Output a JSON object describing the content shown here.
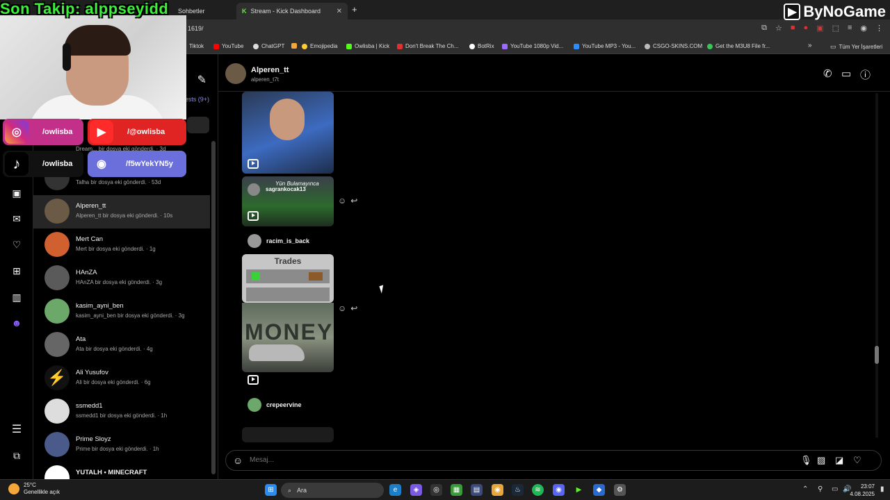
{
  "overlay": {
    "stream_text": "Son Takip: alppseyidd"
  },
  "brand": {
    "name": "ByNoGame"
  },
  "browser": {
    "tabs": [
      {
        "label": "Sohbetler",
        "active": false
      },
      {
        "label": "Stream - Kick Dashboard",
        "active": false
      }
    ],
    "new_tab": "+",
    "url": "1619/",
    "bookmarks": [
      {
        "label": "Tiktok",
        "color": "#ffffff"
      },
      {
        "label": "YouTube",
        "color": "#ff0000"
      },
      {
        "label": "ChatGPT",
        "color": "#dddddd"
      },
      {
        "label": "",
        "color": "#f4a83a"
      },
      {
        "label": "Emojipedia",
        "color": "#ffcc33"
      },
      {
        "label": "Owlisba | Kick",
        "color": "#53fc18"
      },
      {
        "label": "Don't Break The Ch...",
        "color": "#e03030"
      },
      {
        "label": "BotRix",
        "color": "#ffffff"
      },
      {
        "label": "YouTube 1080p Vid...",
        "color": "#9b6bff"
      },
      {
        "label": "YouTube MP3 - You...",
        "color": "#2a8cff"
      },
      {
        "label": "CSGO-SKINS.COM",
        "color": "#bbbbbb"
      },
      {
        "label": "Get the M3U8 File fr...",
        "color": "#38c55a"
      },
      {
        "label": "»",
        "color": ""
      },
      {
        "label": "Tüm Yer İşaretleri",
        "color": ""
      }
    ]
  },
  "socials": [
    {
      "label": "/owlisba",
      "icon": "instagram-icon",
      "color": "#c3308a"
    },
    {
      "label": "/@owlisba",
      "icon": "youtube-icon",
      "color": "#e02424"
    },
    {
      "label": "/owlisba",
      "icon": "tiktok-icon",
      "color": "#111111"
    },
    {
      "label": "/f5wYekYN5y",
      "icon": "discord-icon",
      "color": "#6b6fdc"
    }
  ],
  "conversations": {
    "requests_label": "ests (9+)",
    "items": [
      {
        "name": "",
        "preview": "Dream... bir dosya eki gönderdi. · 3d"
      },
      {
        "name": "",
        "preview": "Talha bir dosya eki gönderdi. · 53d"
      },
      {
        "name": "Alperen_tt",
        "preview": "Alperen_tt bir dosya eki gönderdi. · 10s"
      },
      {
        "name": "Mert Can",
        "preview": "Mert bir dosya eki gönderdi. · 1g"
      },
      {
        "name": "HAnZA",
        "preview": "HAnZA bir dosya eki gönderdi. · 3g"
      },
      {
        "name": "kasim_ayni_ben",
        "preview": "kasim_ayni_ben bir dosya eki gönderdi. · 3g"
      },
      {
        "name": "Ata",
        "preview": "Ata bir dosya eki gönderdi. · 4g"
      },
      {
        "name": "Ali Yusufov",
        "preview": "Ali bir dosya eki gönderdi. · 6g"
      },
      {
        "name": "ssmedd1",
        "preview": "ssmedd1 bir dosya eki gönderdi. · 1h"
      },
      {
        "name": "Prime Sloyz",
        "preview": "Prime bir dosya eki gönderdi. · 1h"
      },
      {
        "name": "YUTALH • MINECRAFT",
        "preview": ""
      }
    ]
  },
  "chat": {
    "name": "Alperen_tt",
    "handle": "alperen_t7t",
    "messages": [
      {
        "sender": "sagrankocak13",
        "caption": "Yün Bulamayınca"
      },
      {
        "sender": "racim_is_back",
        "caption": ""
      },
      {
        "sender": "crepeervine",
        "caption": ""
      }
    ],
    "trades_label": "Trades",
    "money_label": "MONEY",
    "input_placeholder": "Mesaj..."
  },
  "taskbar": {
    "temperature": "25°C",
    "weather": "Genellikle açık",
    "search_label": "Ara",
    "time": "23:07",
    "date": "4.08.2025"
  }
}
